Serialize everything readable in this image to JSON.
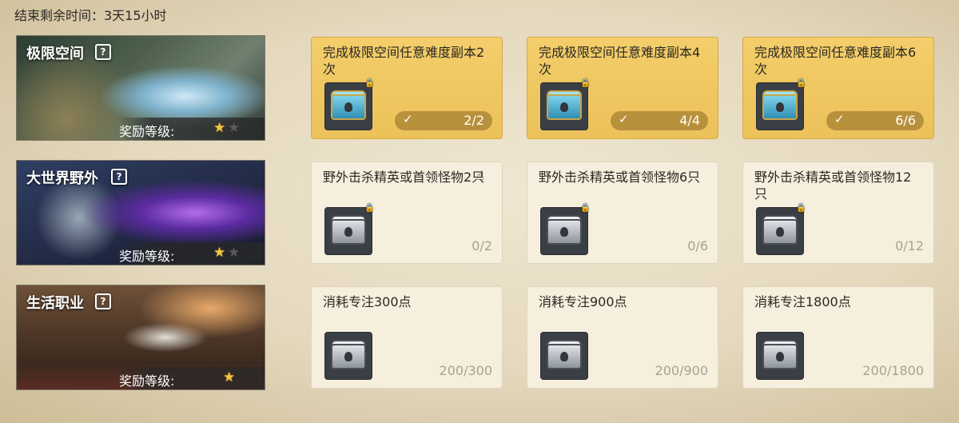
{
  "timer_text": "结束剩余时间：3天15小时",
  "colors": {
    "done_bg": "#f3ce6a",
    "todo_bg": "#f6efdd",
    "star": "#f4c548"
  },
  "rank_label": "奖励等级:",
  "help_glyph": "?",
  "check_glyph": "✓",
  "categories": [
    {
      "name": "极限空间",
      "stars_total": 2,
      "stars_filled": 1
    },
    {
      "name": "大世界野外",
      "stars_total": 2,
      "stars_filled": 1
    },
    {
      "name": "生活职业",
      "stars_total": 1,
      "stars_filled": 1
    }
  ],
  "rows": [
    [
      {
        "desc": "完成极限空间任意难度副本2次",
        "progress": "2/2",
        "done": true,
        "chest": "blue-chest-icon"
      },
      {
        "desc": "完成极限空间任意难度副本4次",
        "progress": "4/4",
        "done": true,
        "chest": "blue-chest-icon"
      },
      {
        "desc": "完成极限空间任意难度副本6次",
        "progress": "6/6",
        "done": true,
        "chest": "blue-chest-icon"
      }
    ],
    [
      {
        "desc": "野外击杀精英或首领怪物2只",
        "progress": "0/2",
        "done": false,
        "chest": "silver-chest-icon"
      },
      {
        "desc": "野外击杀精英或首领怪物6只",
        "progress": "0/6",
        "done": false,
        "chest": "silver-chest-icon"
      },
      {
        "desc": "野外击杀精英或首领怪物12只",
        "progress": "0/12",
        "done": false,
        "chest": "silver-chest-icon"
      }
    ],
    [
      {
        "desc": "消耗专注300点",
        "progress": "200/300",
        "done": false,
        "chest": "silver-chest-icon"
      },
      {
        "desc": "消耗专注900点",
        "progress": "200/900",
        "done": false,
        "chest": "silver-chest-icon"
      },
      {
        "desc": "消耗专注1800点",
        "progress": "200/1800",
        "done": false,
        "chest": "silver-chest-icon"
      }
    ]
  ]
}
